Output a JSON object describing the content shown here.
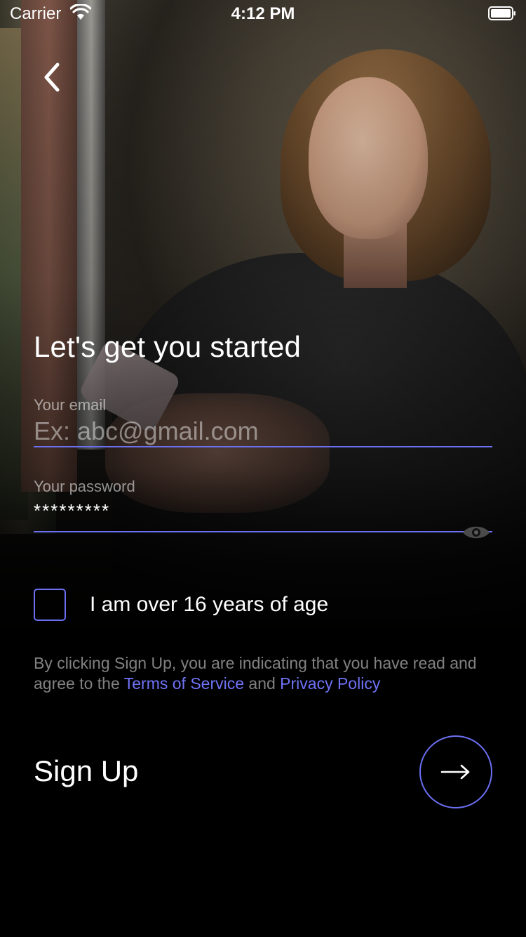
{
  "status_bar": {
    "carrier": "Carrier",
    "time": "4:12 PM",
    "wifi_icon": "wifi-icon",
    "battery_icon": "battery-icon"
  },
  "nav": {
    "back_icon": "chevron-left-icon"
  },
  "form": {
    "title": "Let's get you started",
    "email": {
      "label": "Your email",
      "placeholder": "Ex: abc@gmail.com",
      "value": ""
    },
    "password": {
      "label": "Your password",
      "value": "*********",
      "toggle_icon": "eye-icon"
    },
    "age_checkbox": {
      "label": "I am over 16 years of age",
      "checked": false
    },
    "terms": {
      "prefix": "By clicking Sign Up, you are indicating that you have read and agree to the",
      "terms_link": "Terms of Service",
      "connector": "and",
      "privacy_link": "Privacy Policy"
    },
    "submit": {
      "label": "Sign Up",
      "button_icon": "arrow-right-icon"
    }
  },
  "colors": {
    "accent": "#6b6ff2",
    "link": "#6f72f5",
    "background": "#000000",
    "text": "#ffffff"
  }
}
